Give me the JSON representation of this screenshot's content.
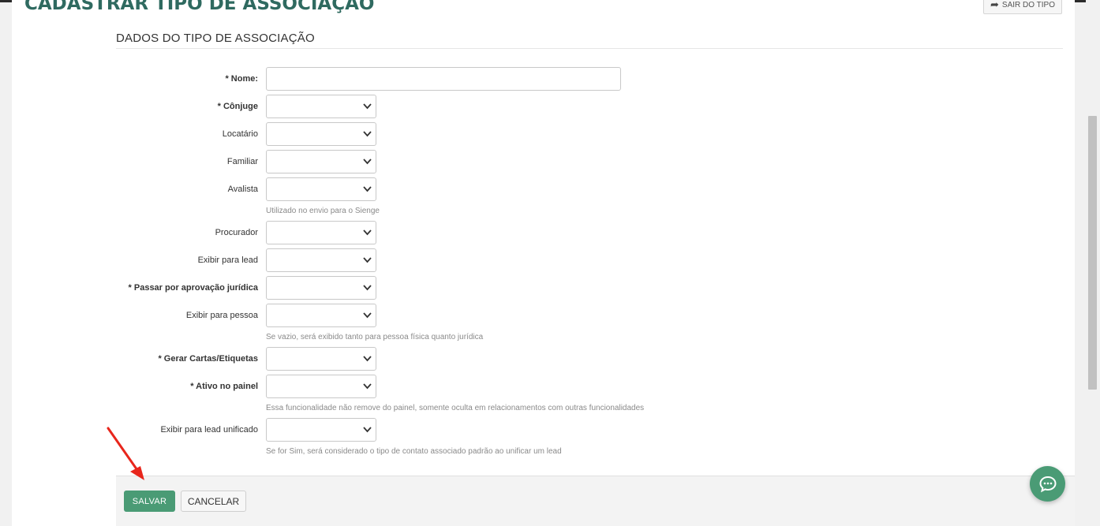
{
  "header": {
    "title": "CADASTRAR TIPO DE ASSOCIAÇÃO",
    "exit_label": "SAIR DO TIPO"
  },
  "section": {
    "title": "DADOS DO TIPO DE ASSOCIAÇÃO"
  },
  "form": {
    "fields": [
      {
        "label": "* Nome:",
        "type": "text",
        "value": ""
      },
      {
        "label": "* Cônjuge",
        "type": "select",
        "value": ""
      },
      {
        "label": "Locatário",
        "type": "select",
        "value": ""
      },
      {
        "label": "Familiar",
        "type": "select",
        "value": ""
      },
      {
        "label": "Avalista",
        "type": "select",
        "value": "",
        "help": "Utilizado no envio para o Sienge"
      },
      {
        "label": "Procurador",
        "type": "select",
        "value": ""
      },
      {
        "label": "Exibir para lead",
        "type": "select",
        "value": ""
      },
      {
        "label": "* Passar por aprovação jurídica",
        "type": "select",
        "value": ""
      },
      {
        "label": "Exibir para pessoa",
        "type": "select",
        "value": "",
        "help": "Se vazio, será exibido tanto para pessoa física quanto jurídica"
      },
      {
        "label": "* Gerar Cartas/Etiquetas",
        "type": "select",
        "value": ""
      },
      {
        "label": "* Ativo no painel",
        "type": "select",
        "value": "",
        "help": "Essa funcionalidade não remove do painel, somente oculta em relacionamentos com outras funcionalidades"
      },
      {
        "label": "Exibir para lead unificado",
        "type": "select",
        "value": "",
        "help": "Se for Sim, será considerado o tipo de contato associado padrão ao unificar um lead"
      }
    ]
  },
  "footer": {
    "save_label": "SALVAR",
    "cancel_label": "CANCELAR"
  },
  "icons": {
    "exit": "share-arrow-icon",
    "chat": "chat-bubble-icon",
    "select": "chevron-down-icon",
    "annotation": "red-arrow-icon"
  },
  "colors": {
    "title": "#2f6a60",
    "primary": "#4a9b75",
    "annotation": "#e8261c"
  }
}
